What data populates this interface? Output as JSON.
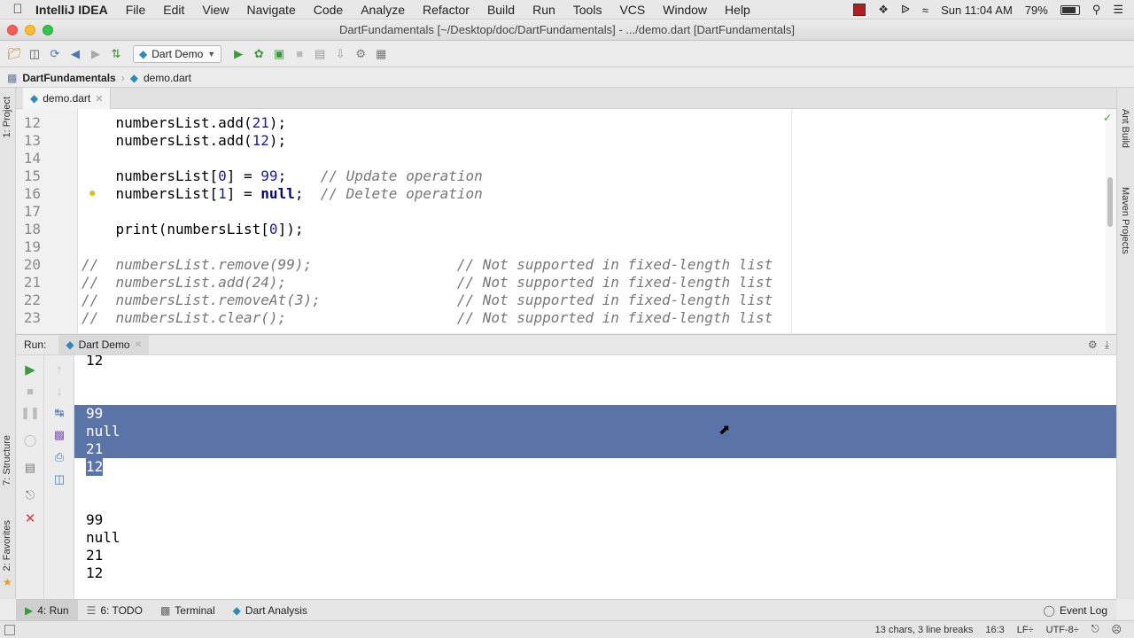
{
  "menubar": {
    "app": "IntelliJ IDEA",
    "items": [
      "File",
      "Edit",
      "View",
      "Navigate",
      "Code",
      "Analyze",
      "Refactor",
      "Build",
      "Run",
      "Tools",
      "VCS",
      "Window",
      "Help"
    ],
    "clock": "Sun 11:04 AM",
    "battery": "79%"
  },
  "window": {
    "title": "DartFundamentals [~/Desktop/doc/DartFundamentals] - .../demo.dart [DartFundamentals]"
  },
  "toolbar": {
    "run_config": "Dart Demo"
  },
  "breadcrumb": {
    "project": "DartFundamentals",
    "file": "demo.dart"
  },
  "editor": {
    "tab": "demo.dart",
    "lines": [
      {
        "n": "12",
        "code": "    numbersList.add(21);"
      },
      {
        "n": "13",
        "code": "    numbersList.add(12);"
      },
      {
        "n": "14",
        "code": ""
      },
      {
        "n": "15",
        "code": "    numbersList[0] = 99;    // Update operation"
      },
      {
        "n": "16",
        "code": "    numbersList[1] = null;  // Delete operation"
      },
      {
        "n": "17",
        "code": ""
      },
      {
        "n": "18",
        "code": "    print(numbersList[0]);"
      },
      {
        "n": "19",
        "code": ""
      },
      {
        "n": "20",
        "code": "//  numbersList.remove(99);                 // Not supported in fixed-length list"
      },
      {
        "n": "21",
        "code": "//  numbersList.add(24);                    // Not supported in fixed-length list"
      },
      {
        "n": "22",
        "code": "//  numbersList.removeAt(3);                // Not supported in fixed-length list"
      },
      {
        "n": "23",
        "code": "//  numbersList.clear();                    // Not supported in fixed-length list"
      }
    ]
  },
  "run_panel": {
    "label": "Run:",
    "tab": "Dart Demo",
    "output_top": "12",
    "output_selected": [
      "99",
      "null",
      "21",
      "12"
    ],
    "output_bottom": [
      "99",
      "null",
      "21",
      "12"
    ]
  },
  "side_tools": {
    "left": [
      "1: Project",
      "7: Structure",
      "2: Favorites"
    ],
    "right": [
      "Ant Build",
      "Maven Projects"
    ]
  },
  "bottom_tabs": {
    "run": "4: Run",
    "todo": "6: TODO",
    "terminal": "Terminal",
    "dart": "Dart Analysis",
    "event_log": "Event Log"
  },
  "status": {
    "selection": "13 chars, 3 line breaks",
    "position": "16:3",
    "line_sep": "LF÷",
    "encoding": "UTF-8÷"
  },
  "colors": {
    "selection": "#5b74a8",
    "run_green": "#3c9a3c",
    "comment": "#777777",
    "number": "#1a1aa8"
  }
}
